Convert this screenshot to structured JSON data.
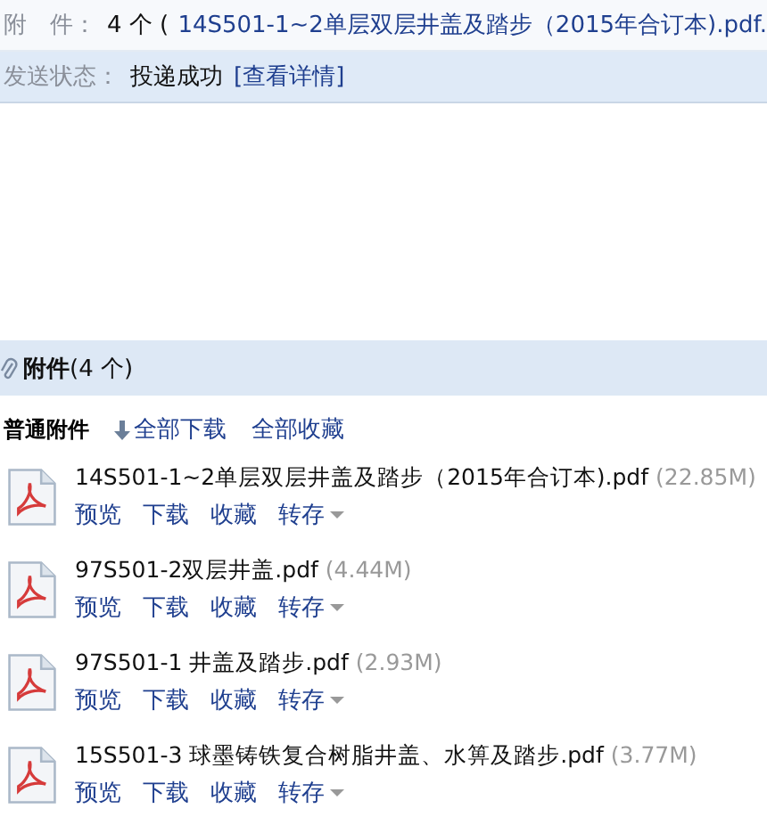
{
  "summary": {
    "label": "附　件：",
    "count": "4 个 (",
    "file_link": "14S501-1~2单层双层井盖及踏步（2015年合订本).pdf."
  },
  "status": {
    "label": "发送状态：",
    "value": "投递成功",
    "details_link": "[查看详情]"
  },
  "attachments_header": {
    "title": "附件",
    "count": "(4 个)"
  },
  "toolbar": {
    "title": "普通附件",
    "download_all": "全部下载",
    "save_all": "全部收藏"
  },
  "files": [
    {
      "name": "14S501-1~2单层双层井盖及踏步（2015年合订本).pdf",
      "size": "(22.85M)",
      "actions": [
        "预览",
        "下载",
        "收藏",
        "转存"
      ]
    },
    {
      "name": "97S501-2双层井盖.pdf",
      "size": "(4.44M)",
      "actions": [
        "预览",
        "下载",
        "收藏",
        "转存"
      ]
    },
    {
      "name": "97S501-1 井盖及踏步.pdf",
      "size": "(2.93M)",
      "actions": [
        "预览",
        "下载",
        "收藏",
        "转存"
      ]
    },
    {
      "name": "15S501-3 球墨铸铁复合树脂井盖、水箅及踏步.pdf",
      "size": "(3.77M)",
      "actions": [
        "预览",
        "下载",
        "收藏",
        "转存"
      ]
    }
  ]
}
